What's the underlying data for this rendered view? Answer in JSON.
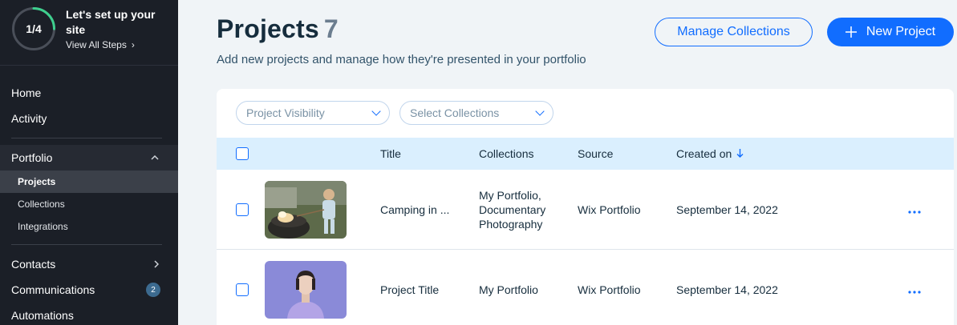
{
  "setup": {
    "progress_label": "1/4",
    "progress_fraction": 0.25,
    "title": "Let's set up your site",
    "link": "View All Steps"
  },
  "nav": {
    "home": "Home",
    "activity": "Activity",
    "portfolio": "Portfolio",
    "portfolio_sub": [
      "Projects",
      "Collections",
      "Integrations"
    ],
    "contacts": "Contacts",
    "communications": "Communications",
    "communications_badge": "2",
    "automations": "Automations"
  },
  "header": {
    "title": "Projects",
    "count": "7",
    "subtitle": "Add new projects and manage how they're presented in your portfolio",
    "manage_button": "Manage Collections",
    "new_button": "New Project"
  },
  "filters": {
    "visibility": "Project Visibility",
    "collections": "Select Collections"
  },
  "table": {
    "columns": {
      "title": "Title",
      "collections": "Collections",
      "source": "Source",
      "created": "Created on"
    },
    "rows": [
      {
        "title": "Camping in ...",
        "collections": [
          "My Portfolio,",
          "Documentary",
          "Photography"
        ],
        "source": "Wix Portfolio",
        "created": "September 14, 2022"
      },
      {
        "title": "Project Title",
        "collections": [
          "My Portfolio"
        ],
        "source": "Wix Portfolio",
        "created": "September 14, 2022"
      }
    ]
  },
  "colors": {
    "accent": "#116dff",
    "sidebar_bg": "#1b1f27",
    "header_row_bg": "#daeffe",
    "progress_ring": "#3ecf8e"
  }
}
